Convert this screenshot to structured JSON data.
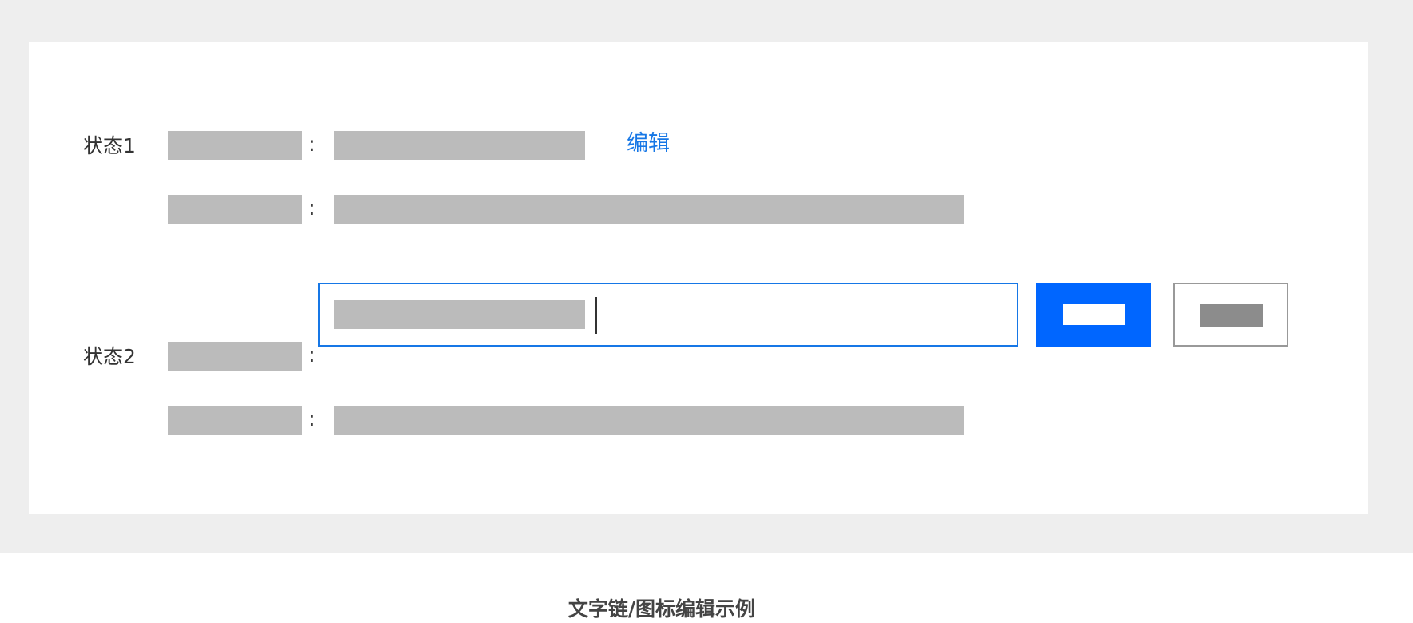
{
  "state1": {
    "label": "状态1",
    "colon": ":",
    "edit_label": "编辑"
  },
  "state2": {
    "label": "状态2",
    "colon": ":"
  },
  "caption": "文字链/图标编辑示例",
  "colors": {
    "accent": "#1677e6",
    "primary_button": "#0066ff",
    "placeholder": "#bbbbbb",
    "background": "#eeeeee"
  }
}
